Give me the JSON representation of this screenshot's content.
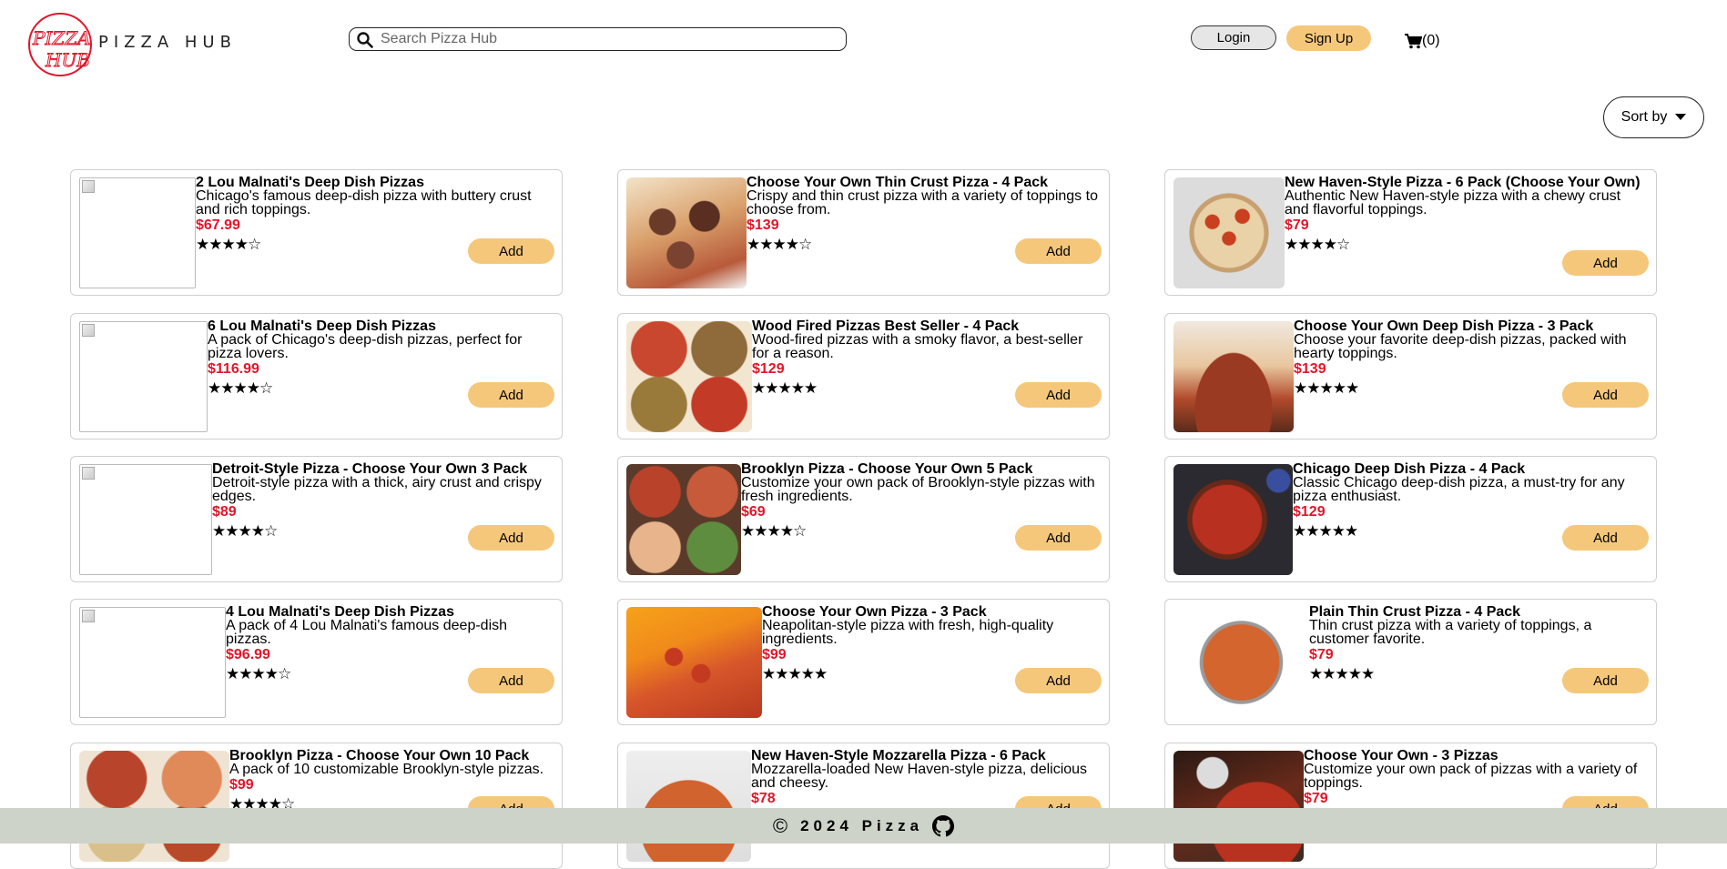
{
  "header": {
    "brand": "PIZZA HUB",
    "search_placeholder": "Search Pizza Hub",
    "login_label": "Login",
    "signup_label": "Sign Up",
    "cart_count": "(0)"
  },
  "sort_label": "Sort by",
  "products": [
    {
      "title": "2 Lou Malnati's Deep Dish Pizzas",
      "desc": "Chicago's famous deep-dish pizza with buttery crust and rich toppings.",
      "price": "$67.99",
      "stars": "★★★★☆",
      "add": "Add",
      "image": "broken"
    },
    {
      "title": "Choose Your Own Thin Crust Pizza - 4 Pack",
      "desc": "Crispy and thin crust pizza with a variety of toppings to choose from.",
      "price": "$139",
      "stars": "★★★★☆",
      "add": "Add",
      "image": "sausage"
    },
    {
      "title": "New Haven-Style Pizza - 6 Pack (Choose Your Own)",
      "desc": "Authentic New Haven-style pizza with a chewy crust and flavorful toppings.",
      "price": "$79",
      "stars": "★★★★☆",
      "add": "Add",
      "image": "pepperoni"
    },
    {
      "title": "6 Lou Malnati's Deep Dish Pizzas",
      "desc": "A pack of Chicago's deep-dish pizzas, perfect for pizza lovers.",
      "price": "$116.99",
      "stars": "★★★★☆",
      "add": "Add",
      "image": "broken"
    },
    {
      "title": "Wood Fired Pizzas Best Seller - 4 Pack",
      "desc": "Wood-fired pizzas with a smoky flavor, a best-seller for a reason.",
      "price": "$129",
      "stars": "★★★★★",
      "add": "Add",
      "image": "four-pizzas"
    },
    {
      "title": "Choose Your Own Deep Dish Pizza - 3 Pack",
      "desc": "Choose your favorite deep-dish pizzas, packed with hearty toppings.",
      "price": "$139",
      "stars": "★★★★★",
      "add": "Add",
      "image": "deep-dish-slice"
    },
    {
      "title": "Detroit-Style Pizza - Choose Your Own 3 Pack",
      "desc": "Detroit-style pizza with a thick, airy crust and crispy edges.",
      "price": "$89",
      "stars": "★★★★☆",
      "add": "Add",
      "image": "broken"
    },
    {
      "title": "Brooklyn Pizza - Choose Your Own 5 Pack",
      "desc": "Customize your own pack of Brooklyn-style pizzas with fresh ingredients.",
      "price": "$69",
      "stars": "★★★★☆",
      "add": "Add",
      "image": "four-pizzas-2"
    },
    {
      "title": "Chicago Deep Dish Pizza - 4 Pack",
      "desc": "Classic Chicago deep-dish pizza, a must-try for any pizza enthusiast.",
      "price": "$129",
      "stars": "★★★★★",
      "add": "Add",
      "image": "chicago"
    },
    {
      "title": "4 Lou Malnati's Deep Dish Pizzas",
      "desc": "A pack of 4 Lou Malnati's famous deep-dish pizzas.",
      "price": "$96.99",
      "stars": "★★★★☆",
      "add": "Add",
      "image": "broken"
    },
    {
      "title": "Choose Your Own Pizza - 3 Pack",
      "desc": "Neapolitan-style pizza with fresh, high-quality ingredients.",
      "price": "$99",
      "stars": "★★★★★",
      "add": "Add",
      "image": "orange-slice"
    },
    {
      "title": "Plain Thin Crust Pizza - 4 Pack",
      "desc": "Thin crust pizza with a variety of toppings, a customer favorite.",
      "price": "$79",
      "stars": "★★★★★",
      "add": "Add",
      "image": "thin-crust"
    },
    {
      "title": "Brooklyn Pizza - Choose Your Own 10 Pack",
      "desc": "A pack of 10 customizable Brooklyn-style pizzas.",
      "price": "$99",
      "stars": "★★★★☆",
      "add": "Add",
      "image": "four-pizzas-3"
    },
    {
      "title": "New Haven-Style Mozzarella Pizza - 6 Pack",
      "desc": "Mozzarella-loaded New Haven-style pizza, delicious and cheesy.",
      "price": "$78",
      "stars": "★★★★☆",
      "add": "Add",
      "image": "mozzarella"
    },
    {
      "title": "Choose Your Own - 3 Pizzas",
      "desc": "Customize your own pack of pizzas with a variety of toppings.",
      "price": "$79",
      "stars": "★★★★★",
      "add": "Add",
      "image": "cutter"
    }
  ],
  "footer": {
    "copyright_symbol": "©",
    "text": "2024 Pizza"
  },
  "colors": {
    "accent": "#f5c77b",
    "price": "#e0162b",
    "footer_bg": "#cdd3c8",
    "logo": "#e0162b"
  },
  "icons": [
    "pizza-hub-logo-icon",
    "search-icon",
    "cart-icon",
    "caret-down-icon",
    "copyright-icon",
    "github-icon"
  ]
}
